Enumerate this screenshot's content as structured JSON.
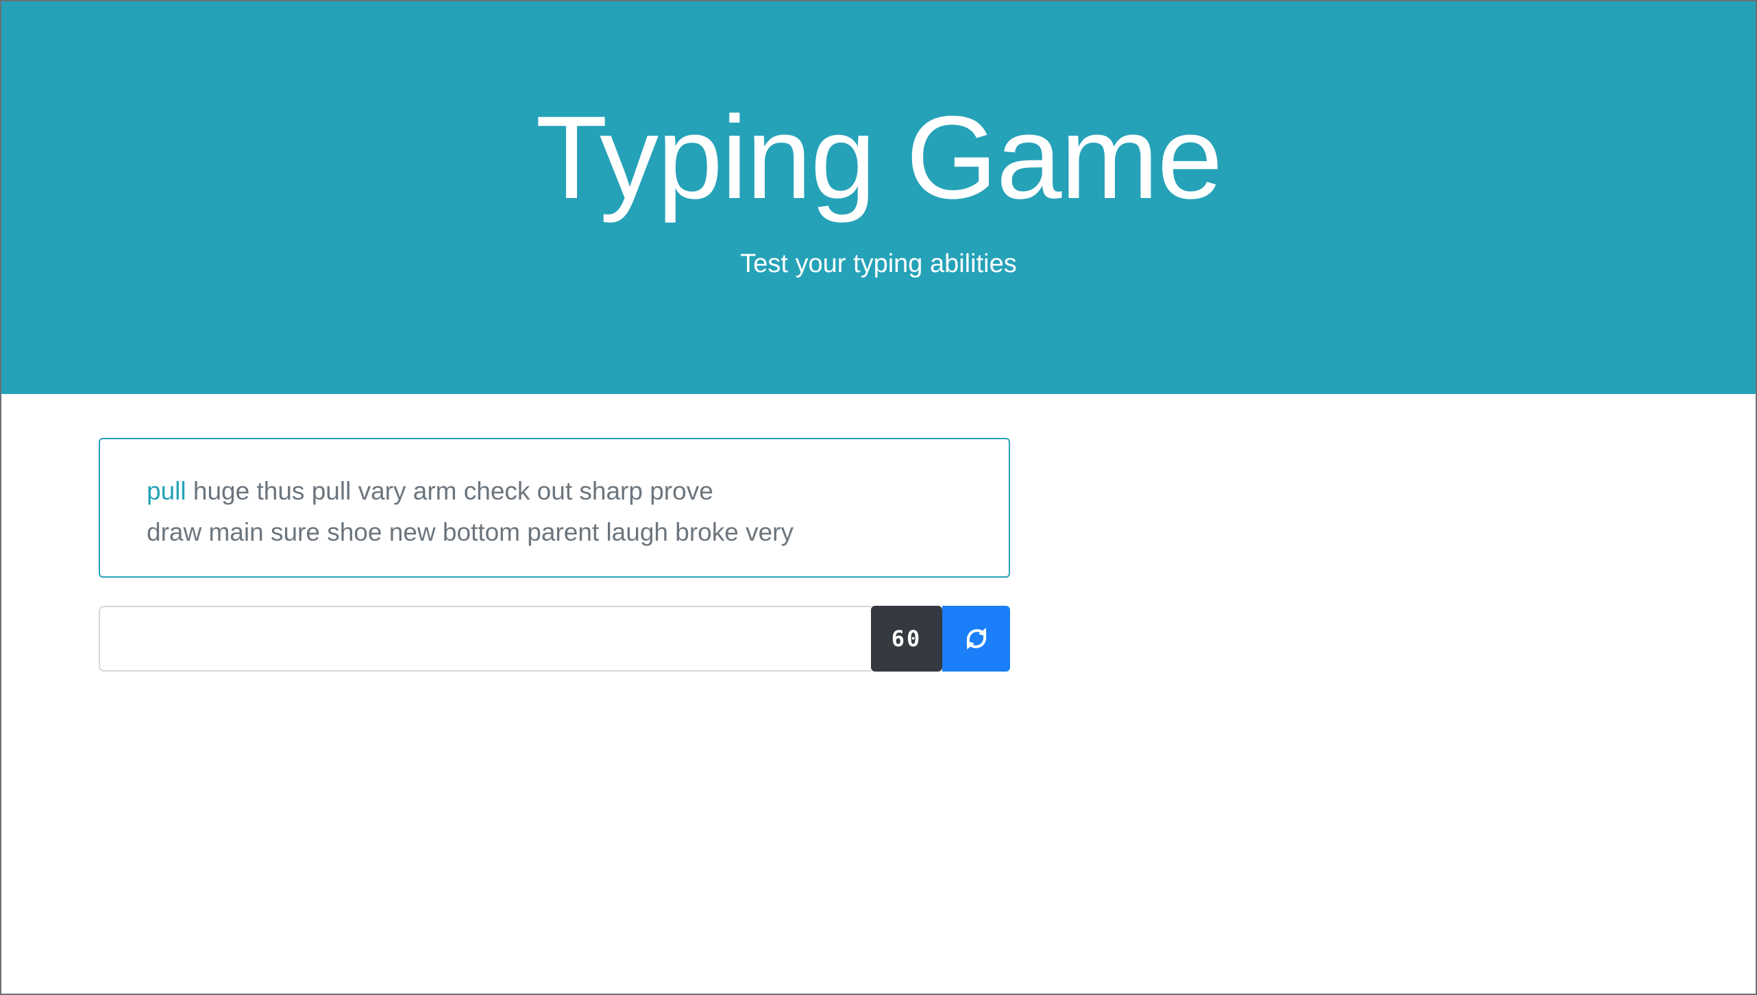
{
  "header": {
    "title": "Typing Game",
    "subtitle": "Test your typing abilities"
  },
  "words": {
    "current_word": "pull",
    "line1_rest": " huge thus pull vary arm check out sharp prove",
    "line2": "draw main sure shoe new bottom parent laugh broke very"
  },
  "input": {
    "value": "",
    "placeholder": ""
  },
  "timer": {
    "value": "60"
  },
  "restart_button": {
    "icon": "refresh-icon"
  },
  "colors": {
    "accent": "#25a2b8",
    "text_muted": "#6c757d",
    "timer_bg": "#343a40",
    "button_primary": "#1a7ff8"
  }
}
